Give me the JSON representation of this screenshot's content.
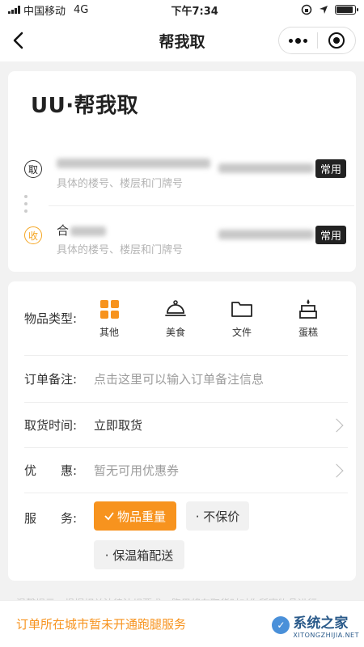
{
  "status_bar": {
    "carrier": "中国移动",
    "network": "4G",
    "time": "下午7:34",
    "battery_level": 0.9
  },
  "nav": {
    "title": "帮我取"
  },
  "brand": "UU·帮我取",
  "pickup": {
    "badge": "取",
    "hint": "具体的楼号、楼层和门牌号",
    "tag": "常用"
  },
  "receive": {
    "badge": "收",
    "name_visible": "合",
    "hint": "具体的楼号、楼层和门牌号",
    "tag": "常用"
  },
  "form": {
    "item_type_label": "物品类型:",
    "item_types": [
      {
        "icon": "grid-icon",
        "label": "其他",
        "color": "#f7931e"
      },
      {
        "icon": "food-cloche-icon",
        "label": "美食"
      },
      {
        "icon": "folder-icon",
        "label": "文件"
      },
      {
        "icon": "cake-icon",
        "label": "蛋糕"
      }
    ],
    "remark_label": "订单备注:",
    "remark_placeholder": "点击这里可以输入订单备注信息",
    "pickup_time_label": "取货时间:",
    "pickup_time_value": "立即取货",
    "coupon_label": "优　　惠:",
    "coupon_value": "暂无可用优惠券",
    "service_label": "服　　务:",
    "services": [
      {
        "label": "物品重量",
        "active": true
      },
      {
        "label": "· 不保价",
        "active": false
      },
      {
        "label": "· 保温箱配送",
        "active": false
      }
    ]
  },
  "notice": "温馨提示：根据相关法律法规要求，跑男将在取货时对你所寄物品进行",
  "bottom": {
    "warning": "订单所在城市暂未开通跑腿服务"
  },
  "watermark": {
    "title": "系统之家",
    "url": "XITONGZHIJIA.NET"
  },
  "colors": {
    "accent": "#f7931e"
  }
}
